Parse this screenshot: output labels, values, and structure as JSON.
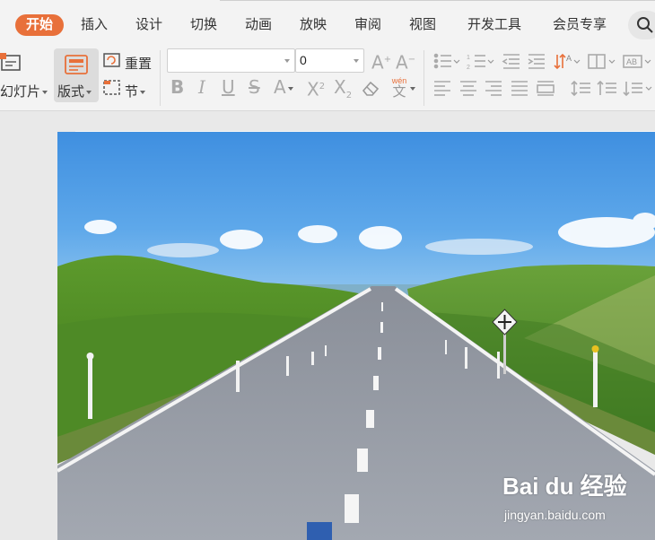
{
  "menu": {
    "tabs": [
      {
        "label": "开始",
        "active": true
      },
      {
        "label": "插入"
      },
      {
        "label": "设计"
      },
      {
        "label": "切换"
      },
      {
        "label": "动画"
      },
      {
        "label": "放映"
      },
      {
        "label": "审阅"
      },
      {
        "label": "视图"
      },
      {
        "label": "开发工具"
      },
      {
        "label": "会员专享"
      }
    ],
    "accent_color": "#e8703a"
  },
  "ribbon": {
    "new_slide_label": "幻灯片",
    "layout_label": "版式",
    "reset_label": "重置",
    "section_label": "节",
    "font_name_value": "",
    "font_size_value": "0",
    "phonetic_label": "wén",
    "phonetic_char": "文"
  },
  "watermark": {
    "logo": "Bai du 经验",
    "url": "jingyan.baidu.com"
  }
}
